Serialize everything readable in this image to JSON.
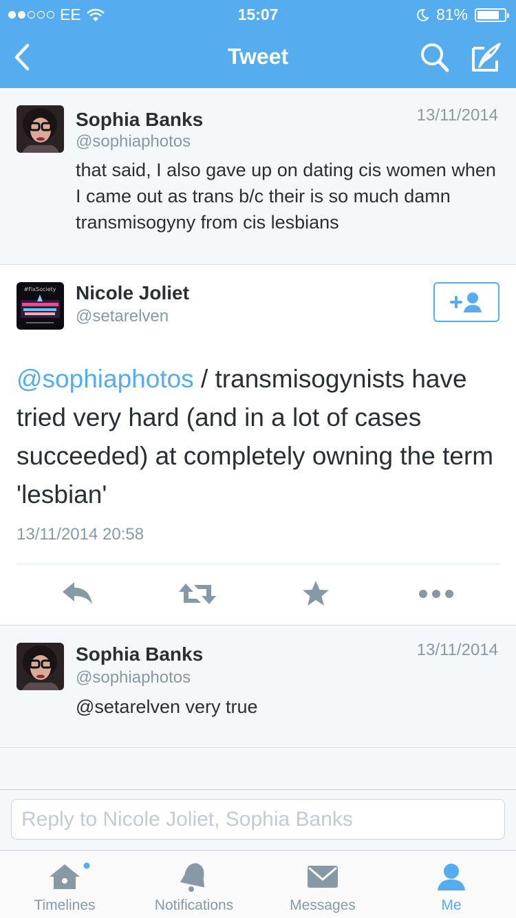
{
  "status_bar": {
    "carrier": "EE",
    "time": "15:07",
    "battery": "81%",
    "battery_level": 0.81
  },
  "nav": {
    "title": "Tweet",
    "icons": [
      "back-chevron-icon",
      "search-icon",
      "compose-icon"
    ]
  },
  "tweets": [
    {
      "name": "Sophia Banks",
      "handle": "@sophiaphotos",
      "date": "13/11/2014",
      "text": "that said, I also gave up on dating cis women when I came out as trans b/c their is so much damn transmisogyny from cis lesbians"
    },
    {
      "name": "Nicole Joliet",
      "handle": "@setarelven",
      "mention": "@sophiaphotos",
      "text_rest": " / transmisogynists have tried very hard (and in a lot of cases succeeded) at completely owning the term 'lesbian'",
      "full_date": "13/11/2014 20:58",
      "avatar_caption": "#FixSociety"
    },
    {
      "name": "Sophia Banks",
      "handle": "@sophiaphotos",
      "date": "13/11/2014",
      "text": "@setarelven very true"
    }
  ],
  "reply": {
    "placeholder": "Reply to Nicole Joliet, Sophia Banks"
  },
  "tabs": [
    {
      "label": "Timelines",
      "icon": "home-icon",
      "active": false,
      "has_dot": true
    },
    {
      "label": "Notifications",
      "icon": "bell-icon",
      "active": false
    },
    {
      "label": "Messages",
      "icon": "envelope-icon",
      "active": false
    },
    {
      "label": "Me",
      "icon": "person-icon",
      "active": true
    }
  ],
  "colors": {
    "brand": "#55acee",
    "text": "#292f33",
    "secondary": "#8899a6",
    "icon_gray": "#8899a6"
  }
}
